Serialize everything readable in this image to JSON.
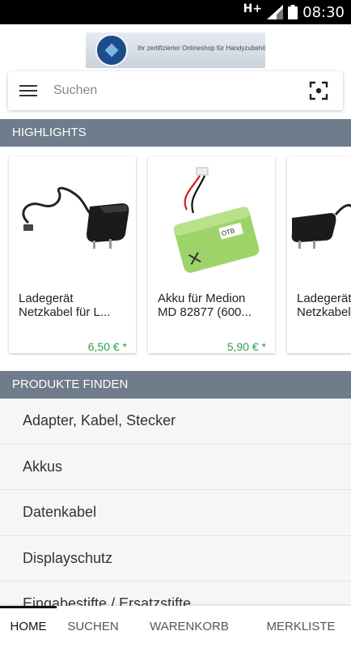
{
  "status_bar": {
    "network": "H+",
    "time": "08:30"
  },
  "header": {
    "logo_text": "Ihr zertifizierter Onlineshop für Handyzubehör!"
  },
  "search": {
    "placeholder": "Suchen",
    "value": ""
  },
  "highlights": {
    "title": "HIGHLIGHTS",
    "products": [
      {
        "name": "Ladegerät Netzkabel für L...",
        "price": "6,50 € *",
        "image": "charger-image"
      },
      {
        "name": "Akku für Medion MD 82877 (600...",
        "price": "5,90 € *",
        "image": "battery-pack-image"
      },
      {
        "name": "Ladegerät Netzkabel",
        "price": "",
        "image": "charger-image"
      }
    ]
  },
  "find_products": {
    "title": "PRODUKTE FINDEN",
    "categories": [
      "Adapter, Kabel, Stecker",
      "Akkus",
      "Datenkabel",
      "Displayschutz",
      "Eingabestifte / Ersatzstifte"
    ]
  },
  "bottom_nav": {
    "tabs": [
      "HOME",
      "SUCHEN",
      "WARENKORB",
      "MERKLISTE"
    ],
    "active": "HOME"
  },
  "colors": {
    "section_header_bg": "#6f7c8c",
    "price": "#2e9e46",
    "status_bar": "#000000"
  }
}
